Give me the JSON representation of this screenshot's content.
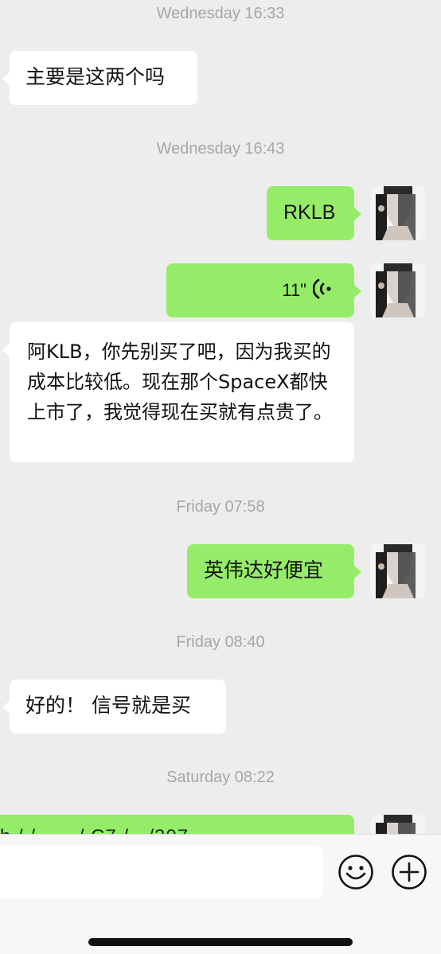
{
  "timestamps": {
    "t1": "Wednesday 16:33",
    "t2": "Wednesday 16:43",
    "t3": "Friday 07:58",
    "t4": "Friday 08:40",
    "t5": "Saturday 08:22"
  },
  "messages": {
    "m1": "主要是这两个吗",
    "m2": "RKLB",
    "m3_voice_duration": "11\"",
    "m4": "阿KLB，你先别买了吧，因为我买的成本比较低。现在那个SpaceX都快上市了，我觉得现在买就有点贵了。",
    "m5": "英伟达好便宜",
    "m6": "好的！ 信号就是买",
    "m7_partial": "h    / /        . ...  /  C7 /  ·   /307"
  },
  "input_bar": {
    "placeholder": "",
    "emoji_icon": "emoji-icon",
    "plus_icon": "plus-icon"
  },
  "colors": {
    "background": "#ededed",
    "incoming_bubble": "#ffffff",
    "outgoing_bubble": "#95ec69",
    "timestamp": "#a6a6a6"
  }
}
